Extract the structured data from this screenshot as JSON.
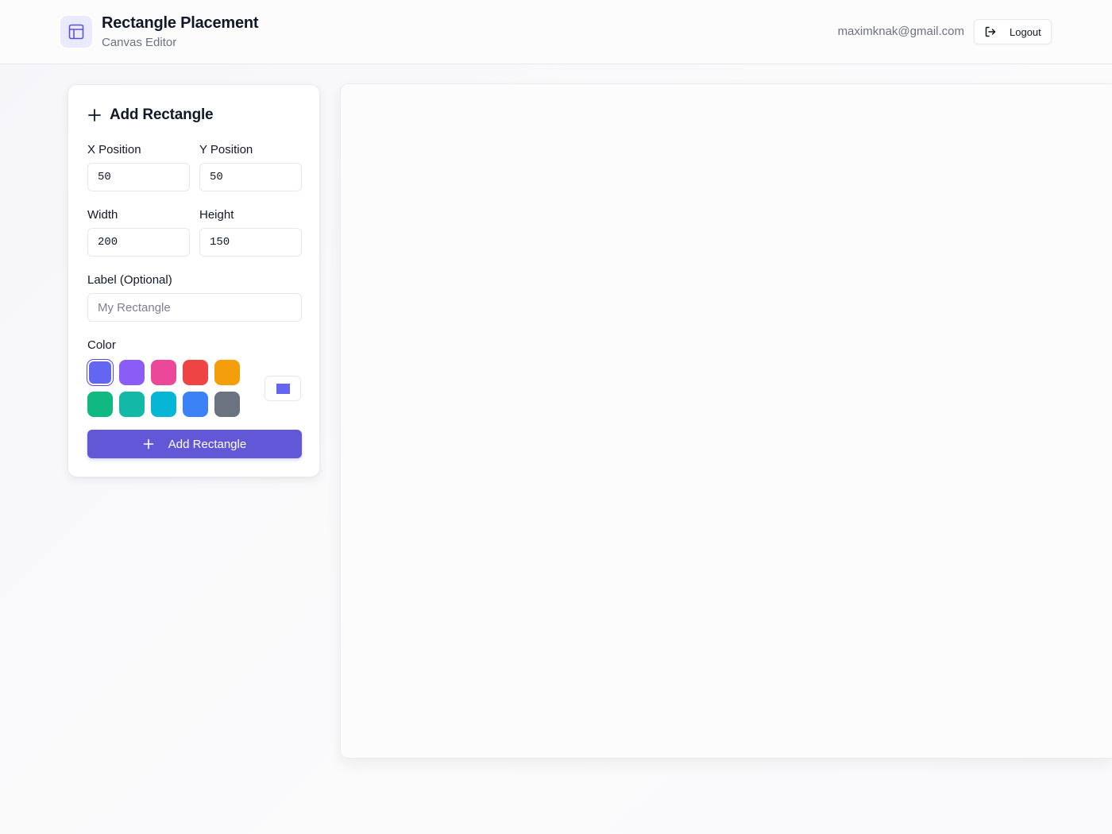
{
  "header": {
    "title": "Rectangle Placement",
    "subtitle": "Canvas Editor",
    "user_email": "maximknak@gmail.com",
    "logout_label": "Logout",
    "logo_icon": "layout-icon"
  },
  "form": {
    "title": "Add Rectangle",
    "x_label": "X Position",
    "x_value": "50",
    "y_label": "Y Position",
    "y_value": "50",
    "width_label": "Width",
    "width_value": "200",
    "height_label": "Height",
    "height_value": "150",
    "label_label": "Label (Optional)",
    "label_placeholder": "My Rectangle",
    "color_label": "Color",
    "colors": [
      "#6366f1",
      "#8b5cf6",
      "#ec4899",
      "#ef4444",
      "#f59e0b",
      "#10b981",
      "#14b8a6",
      "#06b6d4",
      "#3b82f6",
      "#6b7280"
    ],
    "selected_color": "#6366f1",
    "submit_label": "Add Rectangle"
  },
  "colors": {
    "accent": "#6257d6"
  }
}
